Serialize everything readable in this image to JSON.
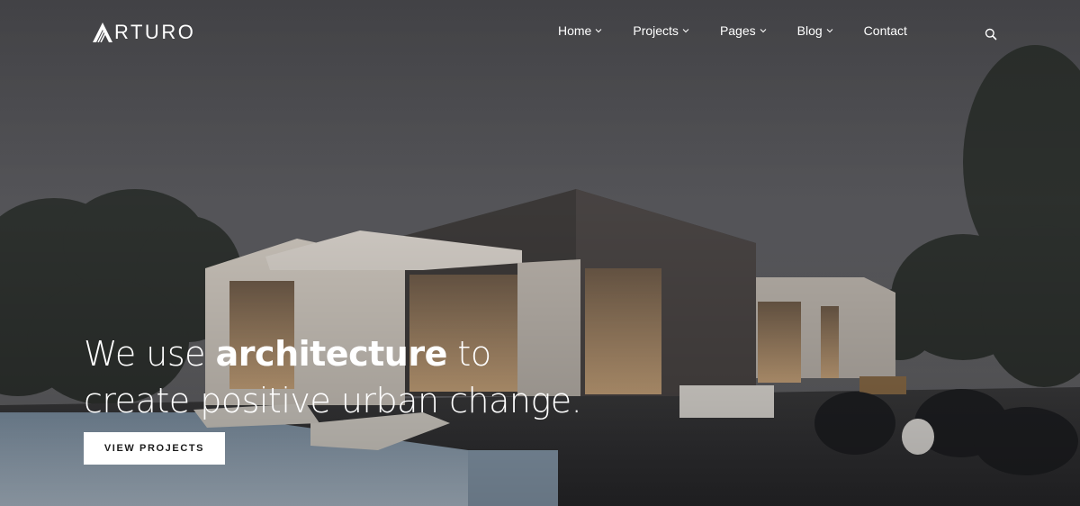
{
  "brand": {
    "logo_text": "RTURO",
    "logo_full": "ARTURO"
  },
  "nav": {
    "items": [
      {
        "label": "Home",
        "has_dropdown": true
      },
      {
        "label": "Projects",
        "has_dropdown": true
      },
      {
        "label": "Pages",
        "has_dropdown": true
      },
      {
        "label": "Blog",
        "has_dropdown": true
      },
      {
        "label": "Contact",
        "has_dropdown": false
      }
    ],
    "search_icon": "search-icon"
  },
  "hero": {
    "headline_pre": "We use ",
    "headline_bold": "architecture",
    "headline_post": " to",
    "headline_line2": "create positive urban change.",
    "cta_label": "VIEW PROJECTS"
  },
  "colors": {
    "text": "#ffffff",
    "button_bg": "#ffffff",
    "button_text": "#1b1b1b",
    "sky": "#5a5a5e"
  }
}
